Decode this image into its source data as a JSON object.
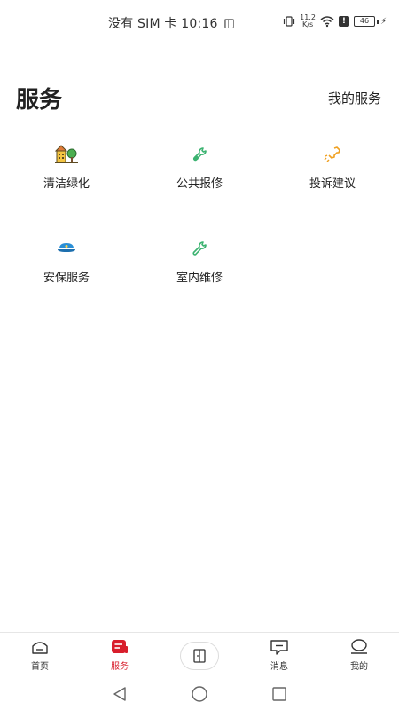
{
  "status": {
    "carrier_time": "没有 SIM 卡 10:16",
    "speed_top": "11.2",
    "speed_bottom": "K/s",
    "battery": "46"
  },
  "header": {
    "title": "服务",
    "my_services": "我的服务"
  },
  "services": [
    {
      "label": "清洁绿化",
      "icon": "building-tree-icon",
      "color": "#4caf50"
    },
    {
      "label": "公共报修",
      "icon": "wrench-icon",
      "color": "#3cb371"
    },
    {
      "label": "投诉建议",
      "icon": "phone-icon",
      "color": "#f0a020"
    },
    {
      "label": "安保服务",
      "icon": "security-cap-icon",
      "color": "#2b8fd6"
    },
    {
      "label": "室内维修",
      "icon": "wrench-icon",
      "color": "#3cb371"
    }
  ],
  "bottom_nav": {
    "home": "首页",
    "service": "服务",
    "messages": "消息",
    "mine": "我的"
  },
  "colors": {
    "accent": "#d81e2c"
  }
}
